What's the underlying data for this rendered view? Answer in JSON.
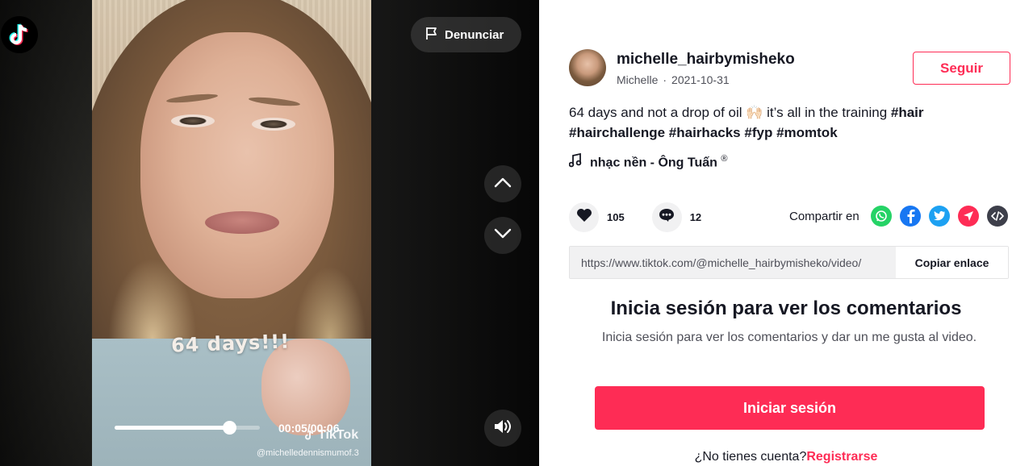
{
  "video": {
    "report_label": "Denunciar",
    "caption_overlay": "64 days!!!",
    "time": "00:05/00:06",
    "progress": 0.79,
    "watermark_brand": "TikTok",
    "watermark_user": "@michelledennismumof.3"
  },
  "post": {
    "username": "michelle_hairbymisheko",
    "display_name": "Michelle",
    "separator": "·",
    "date": "2021-10-31",
    "follow_label": "Seguir",
    "description_text": "64 days and not a drop of oil 🙌🏻 it’s all in the training",
    "hashtags": [
      "#hair",
      "#hairchallenge",
      "#hairhacks",
      "#fyp",
      "#momtok"
    ],
    "music": "nhạc nền - Ông Tuấn",
    "music_mark": "®"
  },
  "actions": {
    "likes": "105",
    "comments": "12",
    "share_label": "Compartir en"
  },
  "link": {
    "url": "https://www.tiktok.com/@michelle_hairbymisheko/video/",
    "copy_label": "Copiar enlace"
  },
  "login": {
    "title": "Inicia sesión para ver los comentarios",
    "subtitle": "Inicia sesión para ver los comentarios y dar un me gusta al video.",
    "button_label": "Iniciar sesión",
    "no_account": "¿No tienes cuenta?",
    "signup_link": "Registrarse"
  },
  "colors": {
    "accent": "#fe2c55",
    "whatsapp": "#25d366",
    "facebook": "#1877f2",
    "twitter": "#1da1f2",
    "telegram": "#fe2c55",
    "embed": "#3d3f4a"
  },
  "icons": [
    "tiktok-logo-icon",
    "flag-icon",
    "chevron-up-icon",
    "chevron-down-icon",
    "volume-icon",
    "music-note-icon",
    "heart-icon",
    "comment-icon",
    "whatsapp-icon",
    "facebook-icon",
    "twitter-icon",
    "send-icon",
    "embed-icon"
  ]
}
